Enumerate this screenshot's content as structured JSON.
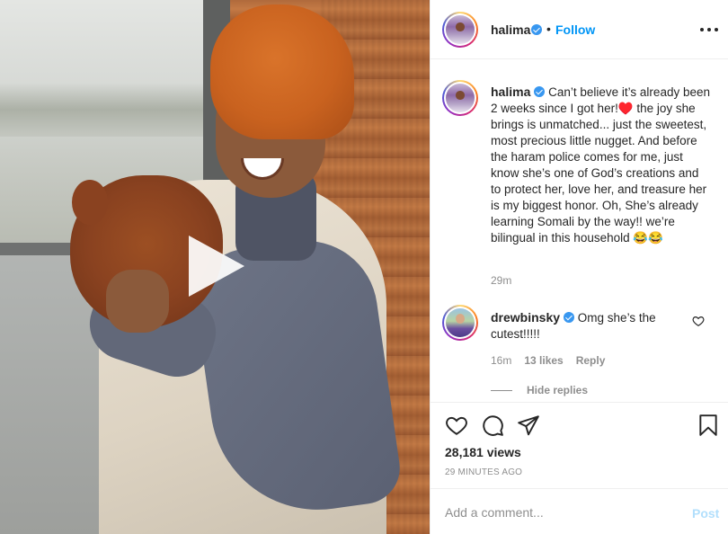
{
  "post": {
    "author": "halima",
    "follow_label": "Follow",
    "separator": "•"
  },
  "caption": {
    "username": "halima",
    "text": "Can’t believe it’s already been 2 weeks since I got her!♥️ the joy she brings is unmatched... just the sweetest, most precious little nugget. And before the haram police comes for me, just know she’s one of God’s creations and to protect her, love her, and treasure her is my biggest honor. Oh, She’s already learning Somali by the way!! we’re bilingual in this household 😂😂",
    "time": "29m"
  },
  "reply": {
    "username": "drewbinsky",
    "text": "Omg she’s the cutest!!!!!",
    "time": "16m",
    "likes": "13 likes",
    "reply_label": "Reply",
    "hide_replies_label": "Hide replies"
  },
  "stats": {
    "views": "28,181 views",
    "posted": "29 MINUTES AGO"
  },
  "comment_box": {
    "placeholder": "Add a comment...",
    "post_label": "Post"
  },
  "icons": {
    "like": "heart-icon",
    "comment": "comment-icon",
    "share": "paper-plane-icon",
    "save": "bookmark-icon",
    "play": "play-icon",
    "more": "more-options-icon",
    "verified": "verified-badge-icon"
  },
  "colors": {
    "link_blue": "#0095f6",
    "verified_blue": "#3897f0",
    "muted_text": "#8e8e8e",
    "post_disabled": "#b2dffc"
  }
}
